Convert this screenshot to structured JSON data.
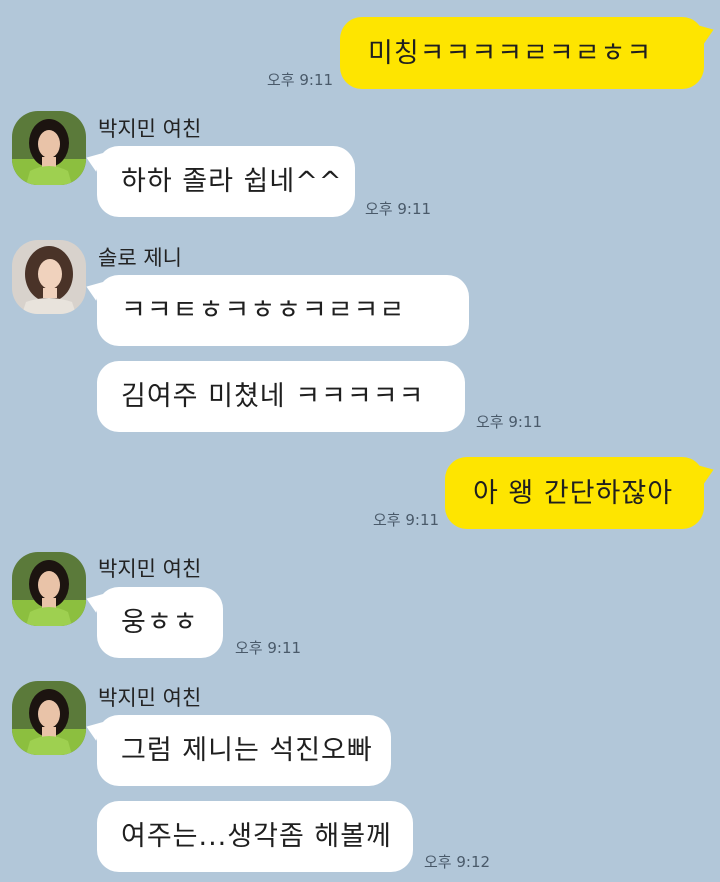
{
  "colors": {
    "background": "#b2c7d9",
    "my_bubble": "#fee500",
    "their_bubble": "#ffffff"
  },
  "messages": [
    {
      "sender": "me",
      "text": "미칭ㅋㅋㅋㅋㄹㅋㄹㅎㅋ",
      "time": "오후 9:11"
    },
    {
      "sender": "박지민 여친",
      "text": "하하 졸라 쉽네^^",
      "time": "오후 9:11"
    },
    {
      "sender": "솔로 제니",
      "text": "ㅋㅋㅌㅎㅋㅎㅎㅋㄹㅋㄹ",
      "time": ""
    },
    {
      "sender": "솔로 제니",
      "text": "김여주 미쳤네 ㅋㅋㅋㅋㅋ",
      "time": "오후 9:11"
    },
    {
      "sender": "me",
      "text": "아 왱 간단하잖아",
      "time": "오후 9:11"
    },
    {
      "sender": "박지민 여친",
      "text": "웅ㅎㅎ",
      "time": "오후 9:11"
    },
    {
      "sender": "박지민 여친",
      "text": "그럼 제니는 석진오빠",
      "time": ""
    },
    {
      "sender": "박지민 여친",
      "text": "여주는...생각좀 해볼께",
      "time": "오후 9:12"
    }
  ]
}
